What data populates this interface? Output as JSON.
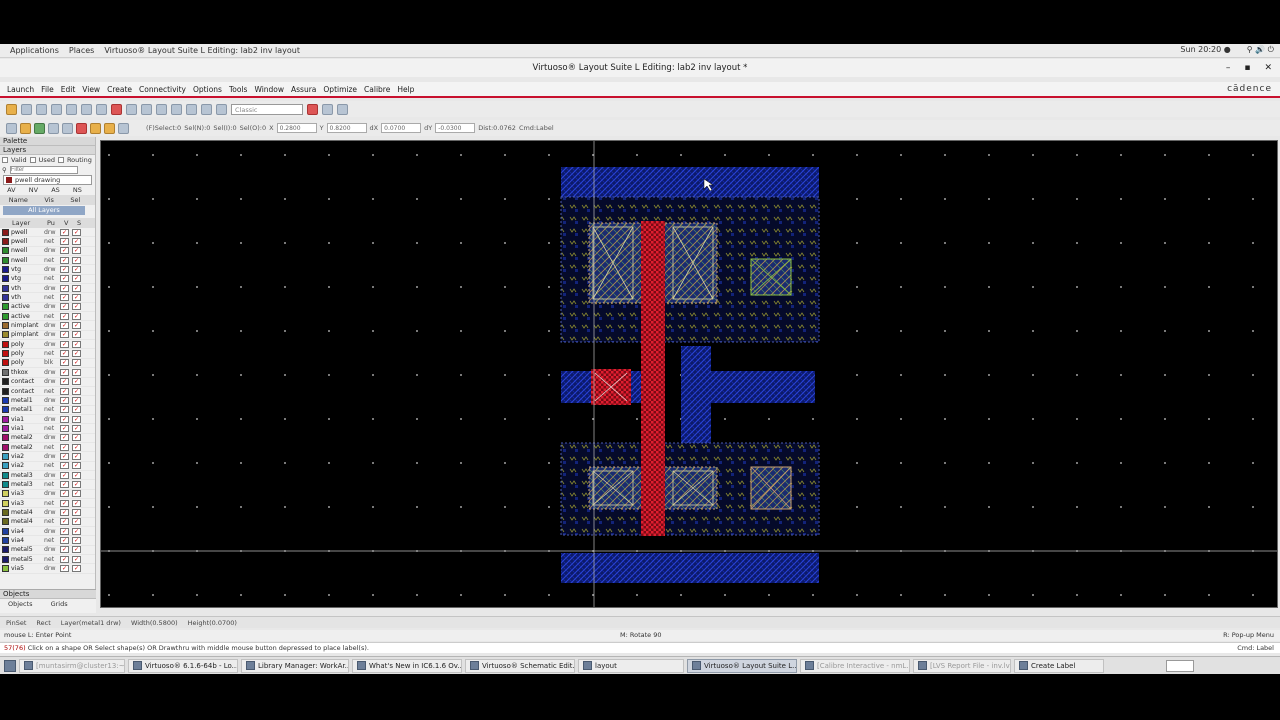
{
  "topbar": {
    "applications": "Applications",
    "places": "Places",
    "window_label": "Virtuoso® Layout Suite L Editing: lab2 inv layout",
    "clock": "Sun 20:20 ●",
    "tray": "⚲ 🔊 ⏻"
  },
  "titlebar": {
    "title": "Virtuoso® Layout Suite L Editing: lab2 inv layout *",
    "minimize": "–",
    "maximize": "▪",
    "close": "✕"
  },
  "menu": {
    "items": [
      "Launch",
      "File",
      "Edit",
      "View",
      "Create",
      "Connectivity",
      "Options",
      "Tools",
      "Window",
      "Assura",
      "Optimize",
      "Calibre",
      "Help"
    ],
    "brand": "cādence"
  },
  "toolbar": {
    "workspace": "Classic"
  },
  "infobar": {
    "select": "(F)Select:0",
    "sel_n": "Sel(N):0",
    "sel_i": "Sel(I):0",
    "sel_o": "Sel(O):0",
    "x_label": "X",
    "x_value": "0.2800",
    "y_label": "Y",
    "y_value": "0.8200",
    "dx_label": "dX",
    "dx_value": "0.0700",
    "dy_label": "dY",
    "dy_value": "-0.0300",
    "dist": "Dist:0.0762",
    "cmd": "Cmd:Label"
  },
  "palette": {
    "title": "Palette",
    "layers_title": "Layers",
    "valid": "Valid",
    "used": "Used",
    "routing": "Routing",
    "filter_placeholder": "Filter",
    "current_layer": "pwell drawing",
    "av": "AV",
    "nv": "NV",
    "as": "AS",
    "ns": "NS",
    "name_col": "Name",
    "vis_col": "Vis",
    "sel_col": "Sel",
    "all_layers": "All Layers",
    "layer_col": "Layer",
    "pu_col": "Pu",
    "v_col": "V",
    "s_col": "S"
  },
  "layers": [
    {
      "name": "pwell",
      "purpose": "drw",
      "color": "#8b1a1a"
    },
    {
      "name": "pwell",
      "purpose": "net",
      "color": "#8b1a1a"
    },
    {
      "name": "nwell",
      "purpose": "drw",
      "color": "#2e8b2e"
    },
    {
      "name": "nwell",
      "purpose": "net",
      "color": "#2e8b2e"
    },
    {
      "name": "vtg",
      "purpose": "drw",
      "color": "#1a1a8b"
    },
    {
      "name": "vtg",
      "purpose": "net",
      "color": "#1a1a8b"
    },
    {
      "name": "vth",
      "purpose": "drw",
      "color": "#333399"
    },
    {
      "name": "vth",
      "purpose": "net",
      "color": "#333399"
    },
    {
      "name": "active",
      "purpose": "drw",
      "color": "#2e9a2e"
    },
    {
      "name": "active",
      "purpose": "net",
      "color": "#2e9a2e"
    },
    {
      "name": "nimplant",
      "purpose": "drw",
      "color": "#9a6a2e"
    },
    {
      "name": "pimplant",
      "purpose": "drw",
      "color": "#9a8a2e"
    },
    {
      "name": "poly",
      "purpose": "drw",
      "color": "#c01010"
    },
    {
      "name": "poly",
      "purpose": "net",
      "color": "#c01010"
    },
    {
      "name": "poly",
      "purpose": "blk",
      "color": "#c01010"
    },
    {
      "name": "thkox",
      "purpose": "drw",
      "color": "#707070"
    },
    {
      "name": "contact",
      "purpose": "drw",
      "color": "#202020"
    },
    {
      "name": "contact",
      "purpose": "net",
      "color": "#202020"
    },
    {
      "name": "metal1",
      "purpose": "drw",
      "color": "#1a3ab0"
    },
    {
      "name": "metal1",
      "purpose": "net",
      "color": "#1a3ab0"
    },
    {
      "name": "via1",
      "purpose": "drw",
      "color": "#a01aa0"
    },
    {
      "name": "via1",
      "purpose": "net",
      "color": "#a01aa0"
    },
    {
      "name": "metal2",
      "purpose": "drw",
      "color": "#a0106a"
    },
    {
      "name": "metal2",
      "purpose": "net",
      "color": "#a0106a"
    },
    {
      "name": "via2",
      "purpose": "drw",
      "color": "#3aa0c0"
    },
    {
      "name": "via2",
      "purpose": "net",
      "color": "#3aa0c0"
    },
    {
      "name": "metal3",
      "purpose": "drw",
      "color": "#108a8a"
    },
    {
      "name": "metal3",
      "purpose": "net",
      "color": "#108a8a"
    },
    {
      "name": "via3",
      "purpose": "drw",
      "color": "#cfcf60"
    },
    {
      "name": "via3",
      "purpose": "net",
      "color": "#cfcf60"
    },
    {
      "name": "metal4",
      "purpose": "drw",
      "color": "#6a6a20"
    },
    {
      "name": "metal4",
      "purpose": "net",
      "color": "#6a6a20"
    },
    {
      "name": "via4",
      "purpose": "drw",
      "color": "#2040a0"
    },
    {
      "name": "via4",
      "purpose": "net",
      "color": "#2040a0"
    },
    {
      "name": "metal5",
      "purpose": "drw",
      "color": "#1a1a6a"
    },
    {
      "name": "metal5",
      "purpose": "net",
      "color": "#1a1a6a"
    },
    {
      "name": "via5",
      "purpose": "drw",
      "color": "#8ac040"
    }
  ],
  "objects_panel": {
    "title": "Objects",
    "objects_tab": "Objects",
    "grids_tab": "Grids"
  },
  "status": {
    "preset": "PinSet",
    "shape": "Rect",
    "layer": "Layer(metal1 drw)",
    "width": "Width(0.5800)",
    "height": "Height(0.0700)"
  },
  "hints": {
    "left": "mouse L: Enter Point",
    "middle": "M: Rotate 90",
    "right": "R: Pop-up Menu"
  },
  "command": {
    "prefix": "57(76)",
    "message": "Click on a shape OR Select shape(s) OR Drawthru with middle mouse button depressed to place label(s).",
    "right": "Cmd: Label"
  },
  "taskbar": [
    {
      "label": "[muntasirm@cluster13:~]",
      "state": "dim"
    },
    {
      "label": "Virtuoso® 6.1.6-64b - Lo...",
      "state": "normal"
    },
    {
      "label": "Library Manager: WorkAr...",
      "state": "normal"
    },
    {
      "label": "What's New in IC6.1.6 Ov...",
      "state": "normal"
    },
    {
      "label": "Virtuoso® Schematic Edit...",
      "state": "normal"
    },
    {
      "label": "layout",
      "state": "normal"
    },
    {
      "label": "Virtuoso® Layout Suite L...",
      "state": "active"
    },
    {
      "label": "[Calibre Interactive - nmL...",
      "state": "dim"
    },
    {
      "label": "[LVS Report File - inv.lvs...",
      "state": "dim"
    },
    {
      "label": "Create Label",
      "state": "normal"
    }
  ],
  "colors": {
    "metal1": "#1a2fc4",
    "poly": "#d4172a",
    "contact_x": "#c8c8a0",
    "dot": "#cfcfcf",
    "accent_red": "#c8102e"
  }
}
